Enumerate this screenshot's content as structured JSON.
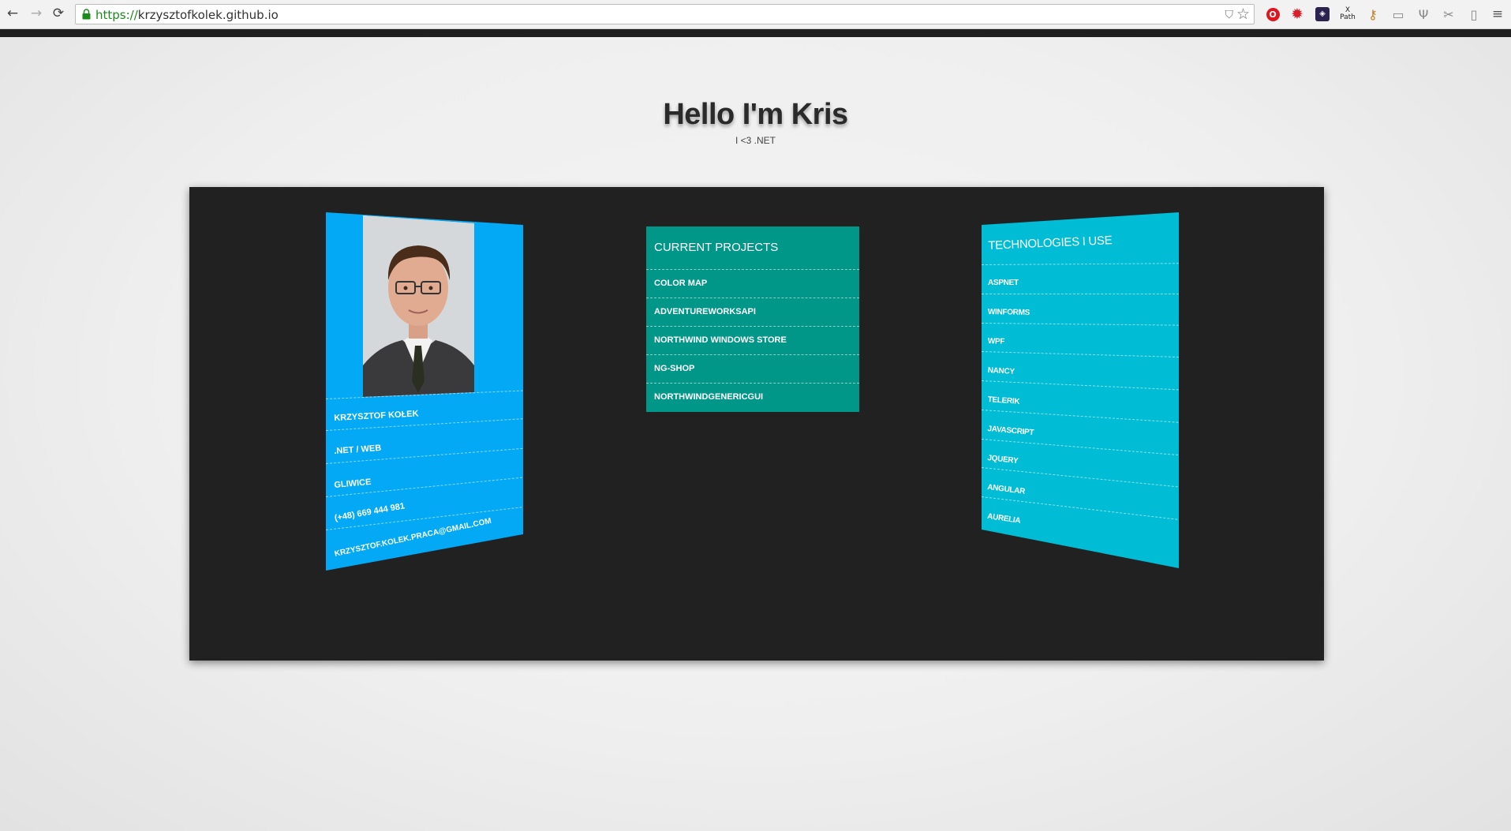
{
  "browser": {
    "url_scheme": "https://",
    "url_host": "krzysztofkolek.github.io",
    "extensions": [
      "opera-icon",
      "gear-icon",
      "extension-icon",
      "xpath-icon",
      "key-icon",
      "cast-icon",
      "tuning-fork-icon",
      "scissors-icon",
      "page-icon",
      "menu-icon"
    ],
    "xpath_label_top": "X",
    "xpath_label_bottom": "Path"
  },
  "hero": {
    "title": "Hello I'm Kris",
    "subtitle": "I <3 .NET"
  },
  "profile": {
    "name": "KRZYSZTOF KOŁEK",
    "role": ".NET / WEB",
    "city": "GLIWICE",
    "phone": "(+48) 669 444 981",
    "email": "KRZYSZTOF.KOLEK.PRACA@GMAIL.COM"
  },
  "projects": {
    "heading": "CURRENT PROJECTS",
    "items": [
      "COLOR MAP",
      "ADVENTUREWORKSAPI",
      "NORTHWIND WINDOWS STORE",
      "NG-SHOP",
      "NORTHWINDGENERICGUI"
    ]
  },
  "technologies": {
    "heading": "TECHNOLOGIES I USE",
    "items": [
      "ASPNET",
      "WINFORMS",
      "WPF",
      "NANCY",
      "TELERIK",
      "JAVASCRIPT",
      "JQUERY",
      "ANGULAR",
      "AURELIA"
    ]
  },
  "colors": {
    "profile_card": "#03a9f4",
    "projects_card": "#009688",
    "tech_card": "#00bcd4",
    "stage": "#212121"
  }
}
